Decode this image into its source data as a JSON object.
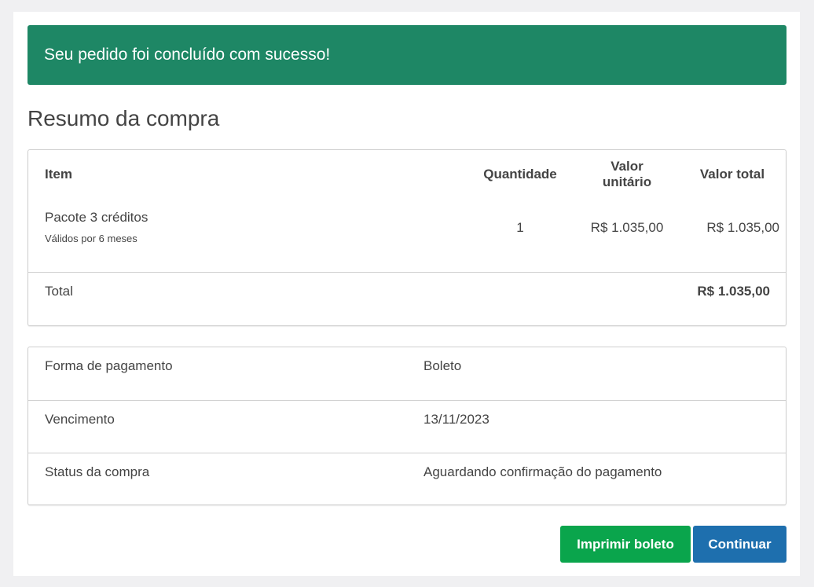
{
  "alert": {
    "message": "Seu pedido foi concluído com sucesso!",
    "color": "#1e8765"
  },
  "page_title": "Resumo da compra",
  "summary": {
    "headers": {
      "item": "Item",
      "quantity": "Quantidade",
      "unit_value_line1": "Valor",
      "unit_value_line2": "unitário",
      "total_value": "Valor total"
    },
    "items": [
      {
        "name": "Pacote 3 créditos",
        "subtitle": "Válidos por 6 meses",
        "quantity": "1",
        "unit_value": "R$ 1.035,00",
        "total_value": "R$ 1.035,00"
      }
    ],
    "total_label": "Total",
    "total_value": "R$ 1.035,00"
  },
  "payment": {
    "rows": [
      {
        "label": "Forma de pagamento",
        "value": "Boleto"
      },
      {
        "label": "Vencimento",
        "value": "13/11/2023"
      },
      {
        "label": "Status da compra",
        "value": "Aguardando confirmação do pagamento"
      }
    ]
  },
  "actions": {
    "print_label": "Imprimir boleto",
    "print_color": "#0aa54c",
    "continue_label": "Continuar",
    "continue_color": "#1e6fae"
  }
}
